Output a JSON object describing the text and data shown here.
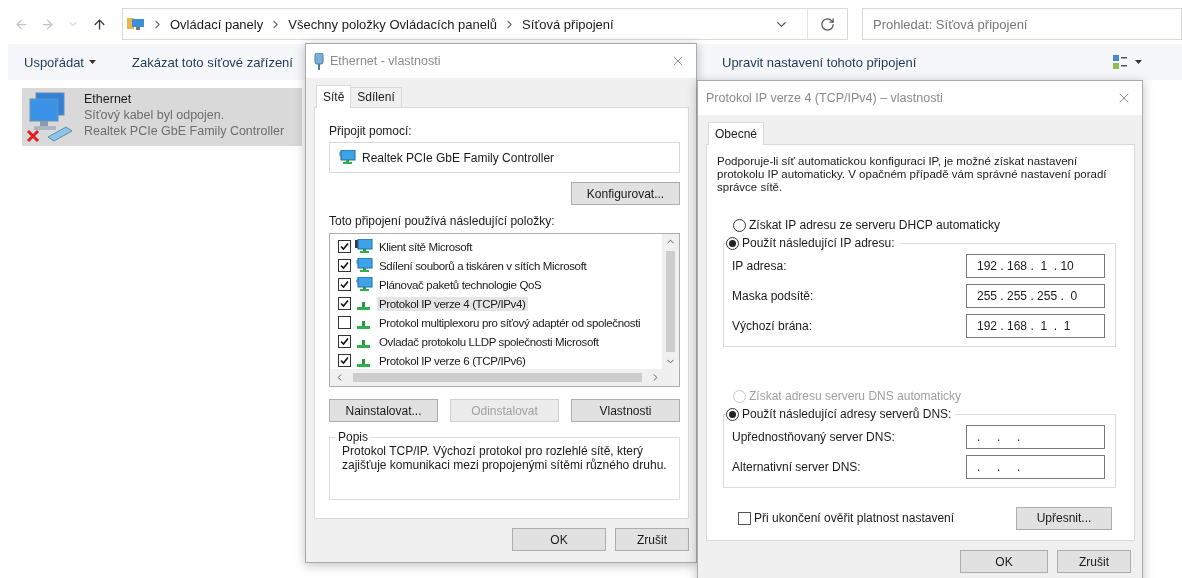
{
  "explorer": {
    "breadcrumb": [
      "Ovládací panely",
      "Všechny položky Ovládacích panelů",
      "Síťová připojení"
    ],
    "search": {
      "placeholder": "Prohledat: Síťová připojení"
    },
    "toolbar": [
      {
        "label": "Uspořádat",
        "dropdown": true
      },
      {
        "label": "Zakázat toto síťové zařízení",
        "dropdown": false
      },
      {
        "label": "Upravit nastavení tohoto připojení",
        "dropdown": false
      }
    ],
    "connections": [
      {
        "name": "Ethernet",
        "status": "Síťový kabel byl odpojen.",
        "device": "Realtek PCIe GbE Family Controller",
        "selected": true,
        "disconnected": true
      }
    ]
  },
  "dialog_ethernet": {
    "title": "Ethernet - vlastnosti",
    "tabs": [
      {
        "label": "Sítě",
        "selected": true
      },
      {
        "label": "Sdílení",
        "selected": false
      }
    ],
    "connect_label": "Připojit pomocí:",
    "adapter": "Realtek PCIe GbE Family Controller",
    "configure_button": "Konfigurovat...",
    "items_label": "Toto připojení používá následující položky:",
    "components": [
      {
        "label": "Klient sítě Microsoft",
        "kind": "client",
        "checked": true,
        "selected": false
      },
      {
        "label": "Sdílení souborů a tiskáren v sítích Microsoft",
        "kind": "service",
        "checked": true,
        "selected": false
      },
      {
        "label": "Plánovač paketů technologie QoS",
        "kind": "service",
        "checked": true,
        "selected": false
      },
      {
        "label": "Protokol IP verze 4 (TCP/IPv4)",
        "kind": "protocol",
        "checked": true,
        "selected": true
      },
      {
        "label": "Protokol multiplexoru pro síťový adaptér od společnosti",
        "kind": "protocol",
        "checked": false,
        "selected": false
      },
      {
        "label": "Ovladač protokolu LLDP společnosti Microsoft",
        "kind": "protocol",
        "checked": true,
        "selected": false
      },
      {
        "label": "Protokol IP verze 6 (TCP/IPv6)",
        "kind": "protocol",
        "checked": true,
        "selected": false
      }
    ],
    "actions": [
      {
        "label": "Nainstalovat...",
        "disabled": false
      },
      {
        "label": "Odinstalovat",
        "disabled": true
      },
      {
        "label": "Vlastnosti",
        "disabled": false
      }
    ],
    "description": {
      "title": "Popis",
      "text": "Protokol TCP/IP. Výchozí protokol pro rozlehlé sítě, který zajišťuje komunikaci mezi propojenými sítěmi různého druhu."
    },
    "buttons": [
      "OK",
      "Zrušit"
    ]
  },
  "dialog_ipv4": {
    "title": "Protokol IP verze 4 (TCP/IPv4) – vlastnosti",
    "tabs": [
      {
        "label": "Obecné",
        "selected": true
      }
    ],
    "intro": "Podporuje-li síť automatickou konfiguraci IP, je možné získat nastavení protokolu IP automaticky. V opačném případě vám správné nastavení poradí správce sítě.",
    "ip_options": [
      {
        "label": "Získat IP adresu ze serveru DHCP automaticky",
        "selected": false,
        "disabled": false
      },
      {
        "label": "Použít následující IP adresu:",
        "selected": true,
        "disabled": false
      }
    ],
    "ip_fields": [
      {
        "label": "IP adresa:",
        "value": "192 . 168 .  1  . 10"
      },
      {
        "label": "Maska podsítě:",
        "value": "255 . 255 . 255 .  0"
      },
      {
        "label": "Výchozí brána:",
        "value": "192 . 168 .  1  .  1"
      }
    ],
    "dns_options": [
      {
        "label": "Získat adresu serveru DNS automaticky",
        "selected": false,
        "disabled": true
      },
      {
        "label": "Použít následující adresy serverů DNS:",
        "selected": true,
        "disabled": false
      }
    ],
    "dns_fields": [
      {
        "label": "Upřednostňovaný server DNS:",
        "value": ".     .     ."
      },
      {
        "label": "Alternativní server DNS:",
        "value": ".     .     ."
      }
    ],
    "validate": {
      "label": "Při ukončení ověřit platnost nastavení",
      "checked": false
    },
    "advanced_button": "Upřesnit...",
    "buttons": [
      "OK",
      "Zrušit"
    ]
  }
}
